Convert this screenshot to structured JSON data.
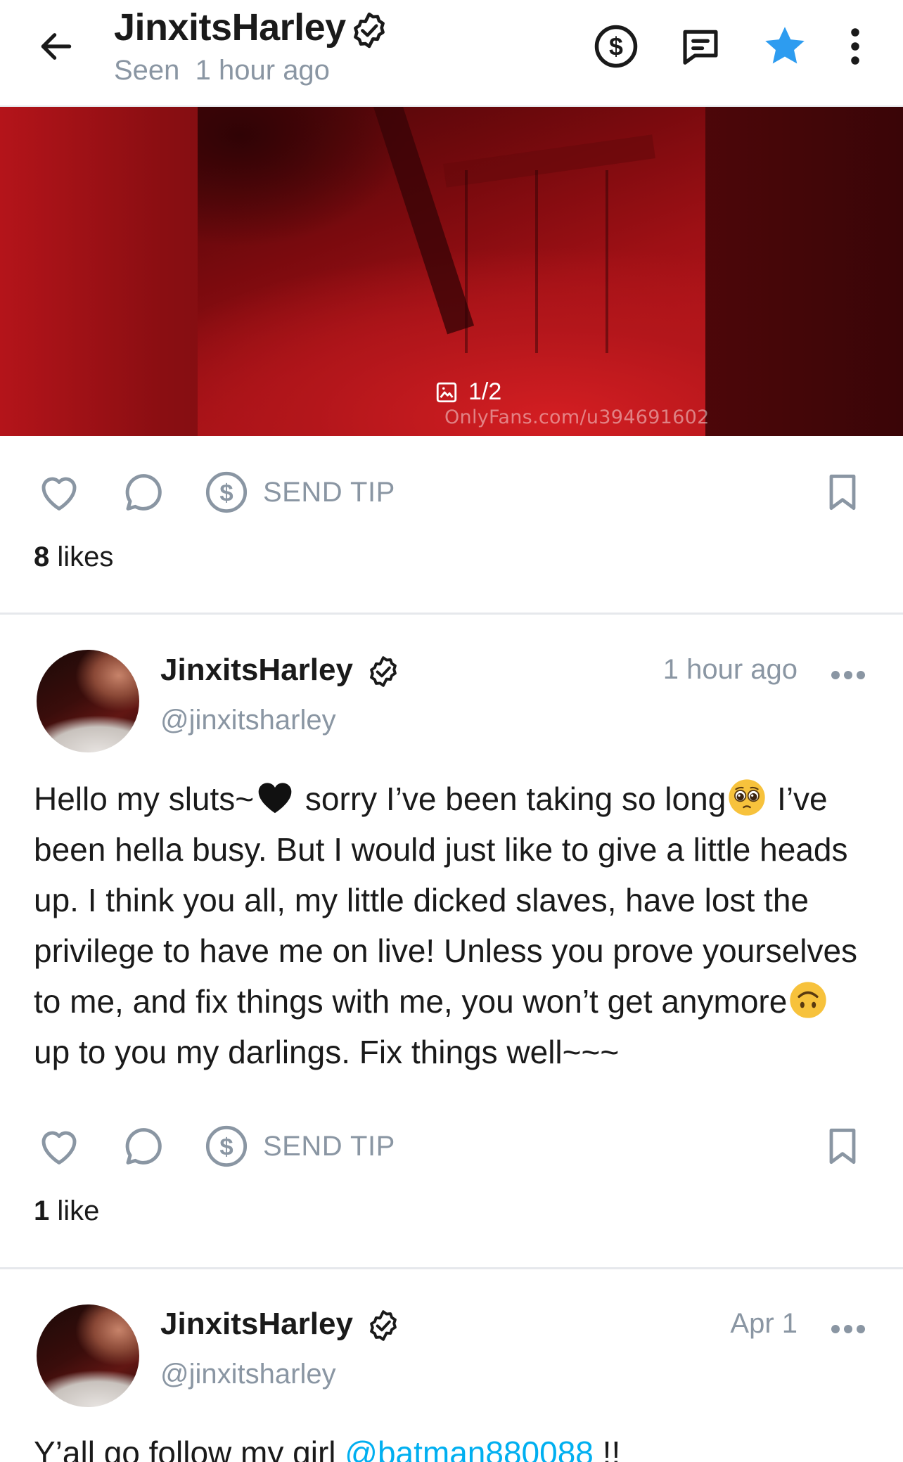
{
  "header": {
    "title": "JinxitsHarley",
    "seen_label": "Seen",
    "seen_time": "1 hour ago",
    "icons": [
      "back-arrow-icon",
      "dollar-circle-icon",
      "message-icon",
      "star-icon",
      "more-vertical-icon"
    ]
  },
  "media": {
    "counter": "1/2",
    "watermark": "OnlyFans.com/u394691602"
  },
  "post1": {
    "tip_label": "SEND TIP",
    "likes_count": "8",
    "likes_word": "likes"
  },
  "post2": {
    "author": "JinxitsHarley",
    "handle": "@jinxitsharley",
    "time": "1 hour ago",
    "text_parts": [
      "Hello my sluts~",
      " sorry I’ve been taking so long",
      " I’ve been hella busy. But I would just like to give a little heads up. I think you all, my little dicked slaves, have lost the privilege to have me on live! Unless you prove yourselves to me, and fix things with me, you won’t get anymore",
      " up to you my darlings. Fix things well~~~"
    ],
    "emojis": [
      "black-heart-emoji",
      "pleading-face-emoji",
      "upside-down-face-emoji"
    ],
    "tip_label": "SEND TIP",
    "likes_count": "1",
    "likes_word": "like"
  },
  "post3": {
    "author": "JinxitsHarley",
    "handle": "@jinxitsharley",
    "time": "Apr 1",
    "text_prefix": "Y’all go follow my girl ",
    "mention": "@batman880088",
    "text_suffix": " !!"
  },
  "colors": {
    "accent": "#00aff0",
    "muted": "#8a96a3",
    "text": "#1a1a1a",
    "divider": "#e6e8ec"
  }
}
